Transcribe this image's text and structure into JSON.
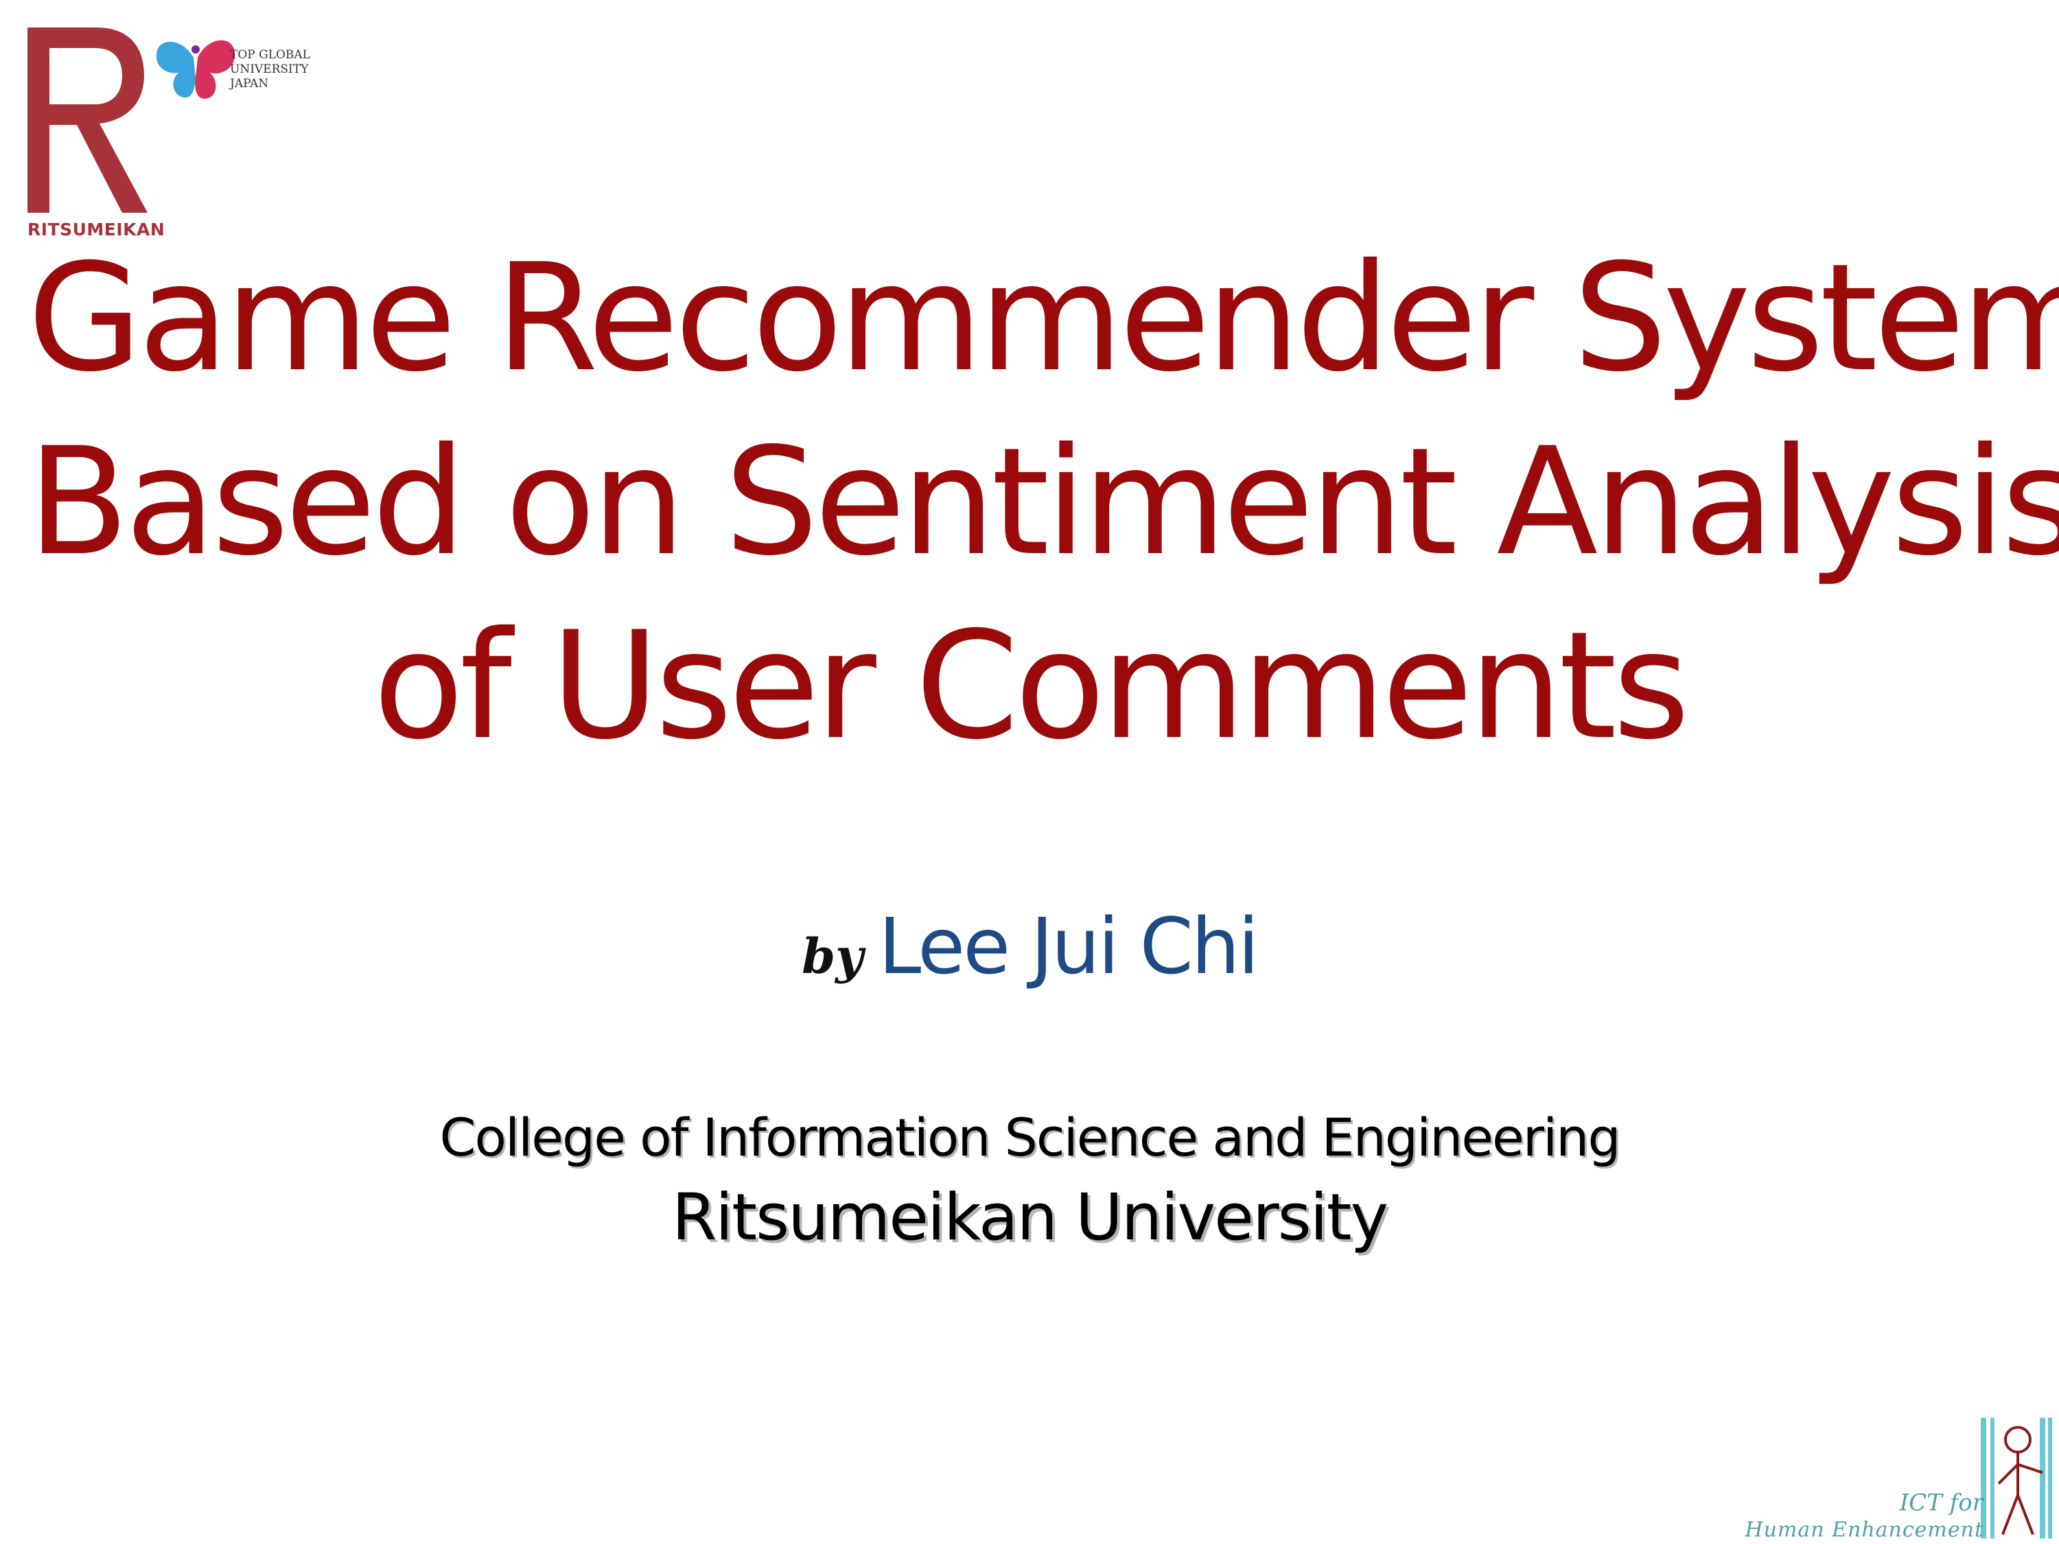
{
  "logos": {
    "university_word": "RITSUMEIKAN",
    "tgu_lines": [
      "TOP GLOBAL",
      "UNIVERSITY",
      "JAPAN"
    ],
    "ict_line1": "ICT for",
    "ict_line2": "Human Enhancement"
  },
  "title": {
    "line1": "Game Recommender System",
    "line2": "Based on Sentiment Analysis",
    "line3": "of User Comments"
  },
  "byline": {
    "by": "by",
    "author": "Lee Jui Chi"
  },
  "affiliation": {
    "college": "College of Information Science and Engineering",
    "university": "Ritsumeikan University"
  },
  "colors": {
    "title": "#9b0a0a",
    "author": "#1f4b85",
    "logo_red": "#a8323a",
    "ict_teal": "#4fa0a8"
  }
}
